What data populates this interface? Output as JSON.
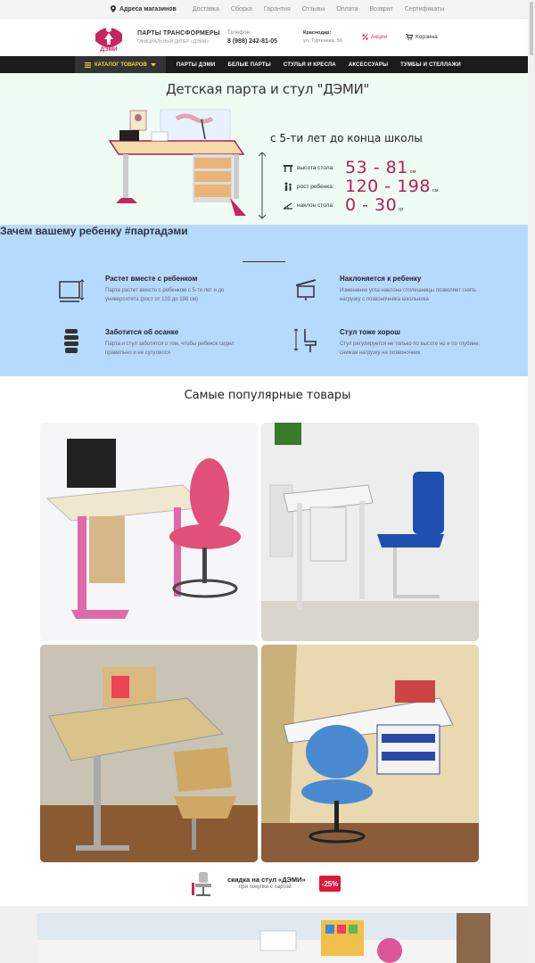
{
  "topbar": {
    "address_label": "Адреса магазинов",
    "links": [
      "Доставка",
      "Сборка",
      "Гарантия",
      "Отзывы",
      "Оплата",
      "Возврат",
      "Сертификаты"
    ]
  },
  "header": {
    "logo_text": "ДЭМИ",
    "title": "ПАРТЫ ТРАНСФОРМЕРЫ",
    "subtitle": "ОФИЦИАЛЬНЫЙ ДИЛЕР «ДЭМИ»",
    "phone_label": "Телефон",
    "phone": "8 (988) 242-81-05",
    "city": "Краснодар:",
    "street": "ул. Тургенева, 56",
    "promo_label": "Акции",
    "cart_label": "Корзина"
  },
  "nav": {
    "catalog_label": "КАТАЛОГ ТОВАРОВ",
    "items": [
      "ПАРТЫ ДЭМИ",
      "БЕЛЫЕ ПАРТЫ",
      "СТУЛЬЯ И КРЕСЛА",
      "АКСЕССУАРЫ",
      "ТУМБЫ И СТЕЛЛАЖИ"
    ]
  },
  "hero": {
    "title": "Детская парта и стул \"ДЭМИ\"",
    "age_text": "с 5-ти лет до конца школы",
    "stats": [
      {
        "label": "высота стола:",
        "value": "53 - 81",
        "unit": "см"
      },
      {
        "label": "рост ребенка:",
        "value": "120 - 198",
        "unit": "см"
      },
      {
        "label": "наклон стола:",
        "value": "0 - 30",
        "unit": "гр"
      }
    ]
  },
  "why": {
    "title": "Зачем вашему ребенку #партадэми",
    "features": [
      {
        "title": "Растет вместе с ребенком",
        "desc": "Парта растет вместе с ребенком с 5-ти лет и до университета (рост от 120 до 198 см)"
      },
      {
        "title": "Наклоняется к ребенку",
        "desc": "Изменение угла наклона столешницы позволяет снять нагрузку с позвоночника школьника"
      },
      {
        "title": "Заботится об осанке",
        "desc": "Парта и стул заботятся о том, чтобы ребенок сидел правильно и не сутулился"
      },
      {
        "title": "Стул тоже хорош",
        "desc": "Стул регулируется не только по высоте но и по глубине, снижая нагрузку на позвоночник"
      }
    ]
  },
  "popular": {
    "title": "Самые популярные товары"
  },
  "promo": {
    "text": "скидка на стул «ДЭМИ»",
    "sub": "при покупке с партой",
    "badge": "-25%"
  },
  "colors": {
    "accent": "#b71c5c",
    "nav_bg": "#1b1b1b",
    "catalog_text": "#f2d13b",
    "hero_bg": "#eefcf4",
    "why_bg": "#b5dafe",
    "badge": "#d81b3c"
  }
}
